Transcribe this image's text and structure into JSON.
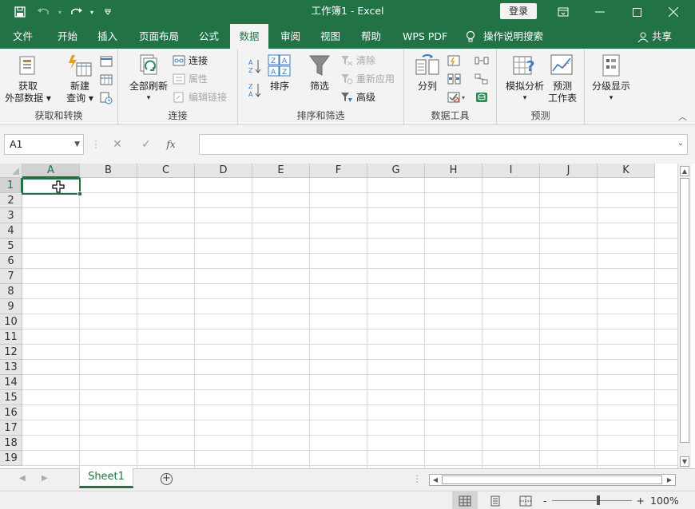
{
  "window": {
    "title": "工作簿1 - Excel",
    "login_label": "登录",
    "accent": "#217346"
  },
  "qat": {
    "save_icon": "save-icon",
    "undo_icon": "undo-icon",
    "redo_icon": "redo-icon",
    "customize_icon": "customize-qat-icon"
  },
  "tabs": [
    {
      "label": "文件",
      "active": false
    },
    {
      "label": "开始",
      "active": false
    },
    {
      "label": "插入",
      "active": false
    },
    {
      "label": "页面布局",
      "active": false
    },
    {
      "label": "公式",
      "active": false
    },
    {
      "label": "数据",
      "active": true
    },
    {
      "label": "审阅",
      "active": false
    },
    {
      "label": "视图",
      "active": false
    },
    {
      "label": "帮助",
      "active": false
    },
    {
      "label": "WPS PDF",
      "active": false
    }
  ],
  "tellme": {
    "label": "操作说明搜索"
  },
  "share": {
    "label": "共享"
  },
  "ribbon": {
    "get_transform": {
      "label": "获取和转换",
      "get_external_line1": "获取",
      "get_external_line2": "外部数据",
      "new_query_line1": "新建",
      "new_query_line2": "查询"
    },
    "connections": {
      "label": "连接",
      "refresh_all": "全部刷新",
      "connections": "连接",
      "properties": "属性",
      "edit_links": "编辑链接"
    },
    "sort_filter": {
      "label": "排序和筛选",
      "sort": "排序",
      "filter": "筛选",
      "clear": "清除",
      "reapply": "重新应用",
      "advanced": "高级"
    },
    "data_tools": {
      "label": "数据工具",
      "text_to_columns": "分列"
    },
    "forecast": {
      "label": "预测",
      "what_if": "模拟分析",
      "forecast_sheet_line1": "预测",
      "forecast_sheet_line2": "工作表"
    },
    "outline": {
      "label": "分级显示"
    }
  },
  "formula_bar": {
    "name_box": "A1",
    "cancel_icon": "✕",
    "enter_icon": "✓",
    "fx_label": "fx",
    "value": ""
  },
  "grid": {
    "columns": [
      "A",
      "B",
      "C",
      "D",
      "E",
      "F",
      "G",
      "H",
      "I",
      "J",
      "K"
    ],
    "rows": [
      "1",
      "2",
      "3",
      "4",
      "5",
      "6",
      "7",
      "8",
      "9",
      "10",
      "11",
      "12",
      "13",
      "14",
      "15",
      "16",
      "17",
      "18",
      "19"
    ],
    "selected_cell": "A1"
  },
  "sheets": [
    {
      "label": "Sheet1",
      "active": true
    }
  ],
  "status": {
    "zoom": "100%",
    "zoom_out": "-",
    "zoom_in": "+"
  }
}
